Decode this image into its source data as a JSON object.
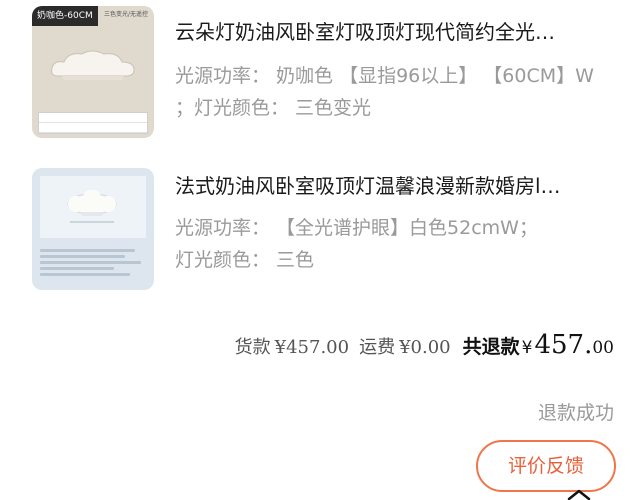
{
  "orders": [
    {
      "thumb_tag": "奶咖色-60CM",
      "thumb_note": "三色变光/无遥控",
      "title": "云朵灯奶油风卧室灯吸顶灯现代简约全光…",
      "spec_line1": "光源功率：  奶咖色 【显指96以上】 【60CM】W",
      "spec_line2": "；灯光颜色：  三色变光"
    },
    {
      "title": "法式奶油风卧室吸顶灯温馨浪漫新款婚房l…",
      "spec_line1": "光源功率：  【全光谱护眼】白色52cmW；",
      "spec_line2": "灯光颜色：  三色"
    }
  ],
  "totals": {
    "goods_label": "货款",
    "goods_value": "¥457.00",
    "shipping_label": "运费",
    "shipping_value": "¥0.00",
    "refund_label": "共退款",
    "refund_yen": "¥",
    "refund_int": "457.",
    "refund_dec": "00"
  },
  "status": "退款成功",
  "review_button": "评价反馈",
  "icons": {
    "chevron": "chevron-up-icon"
  },
  "colors": {
    "accent": "#f0764a",
    "muted": "#9a9a9a"
  }
}
